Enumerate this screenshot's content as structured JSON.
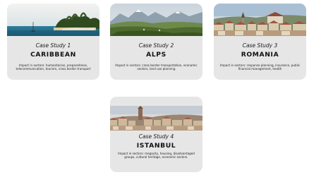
{
  "case_studies": [
    {
      "label": "Case Study 1",
      "title": "CARIBBEAN",
      "description": "Impact in sectors: humanitarian, preparedness, telecommunication, tourism, cross border transport",
      "image": "tropical-island-beach-photo"
    },
    {
      "label": "Case Study 2",
      "title": "ALPS",
      "description": "Impact in sectors: cross border transportation, economic sectors, land use planning",
      "image": "alpine-mountain-valley-photo"
    },
    {
      "label": "Case Study 3",
      "title": "ROMANIA",
      "description": "Impact in sectors: response planning, insurance, public financial management, health",
      "image": "romanian-hilltown-photo"
    },
    {
      "label": "Case Study 4",
      "title": "ISTANBUL",
      "description": "Impact in sectors: megacity, housing, disadvantaged groups, cultural heritage, economic sectors.",
      "image": "istanbul-skyline-photo"
    }
  ],
  "colors": {
    "card_background": "#e6e6e6",
    "text": "#111111"
  }
}
